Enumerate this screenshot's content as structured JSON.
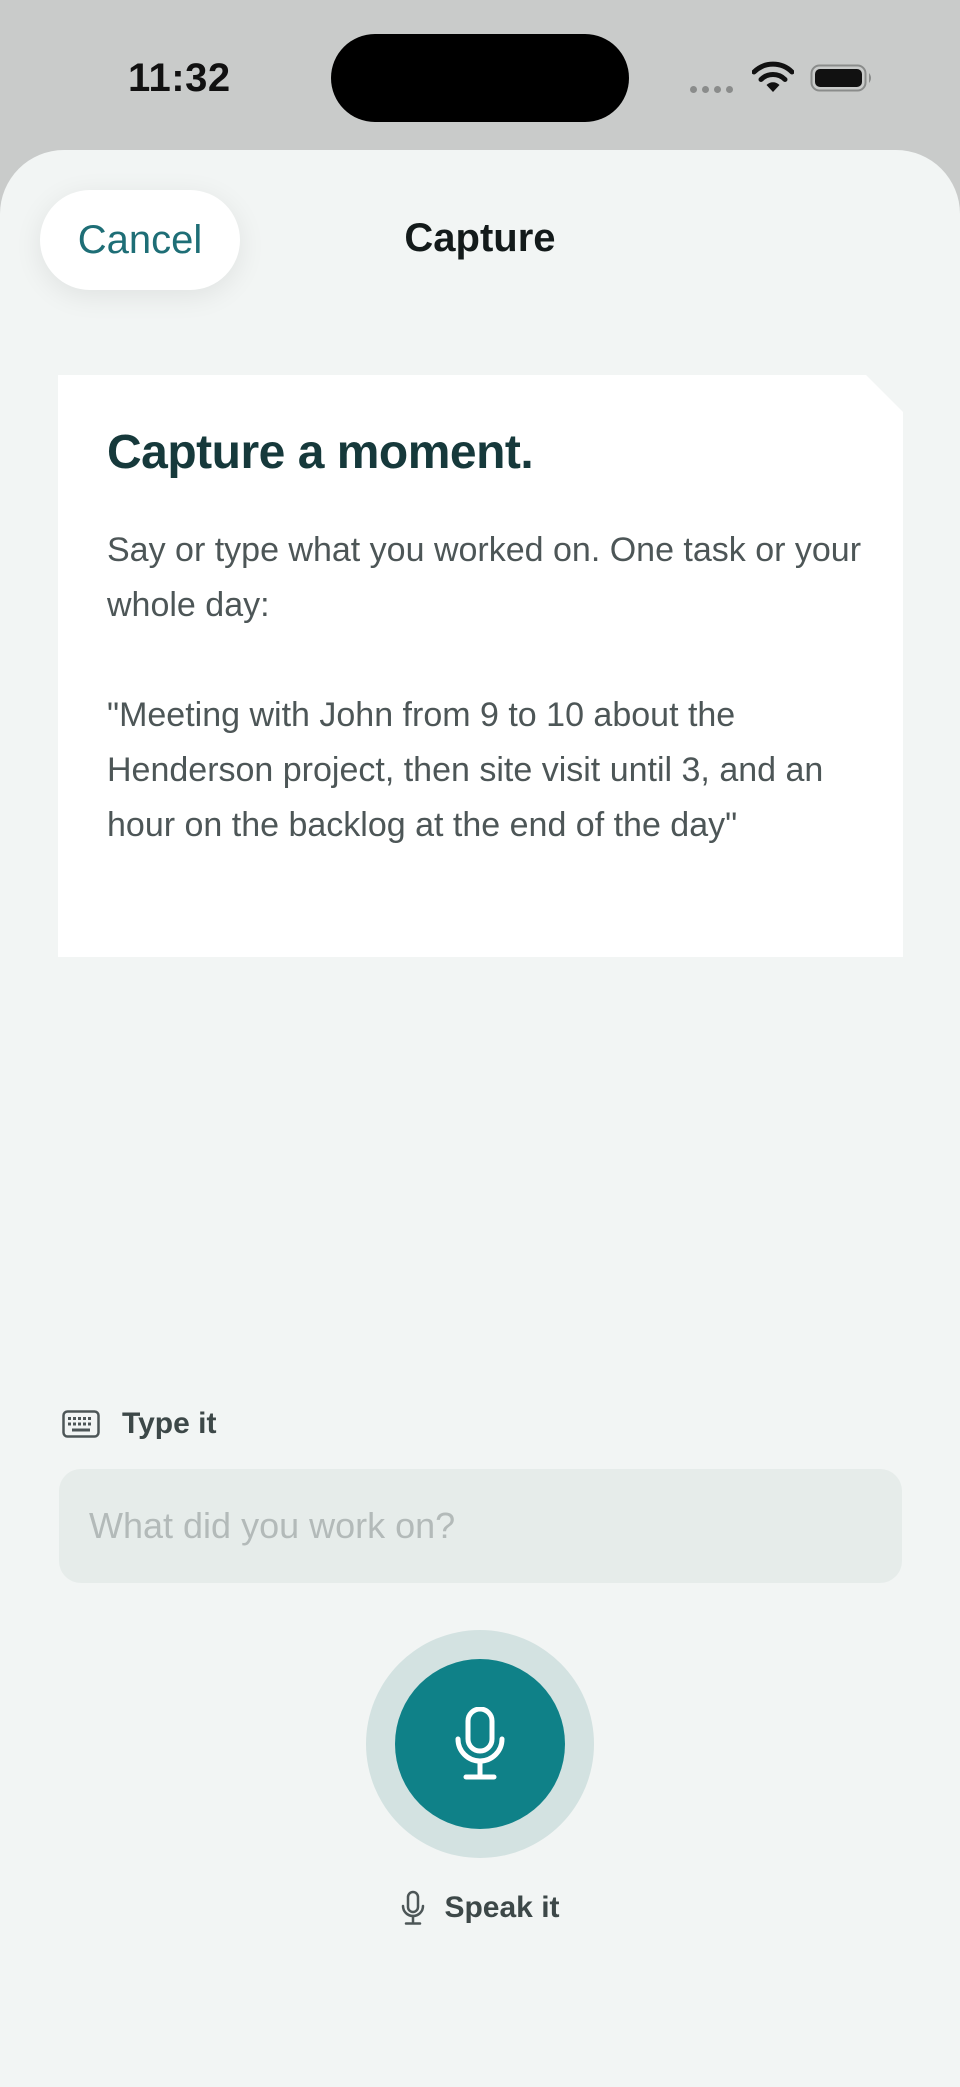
{
  "status_bar": {
    "time": "11:32",
    "icons": [
      "cellular-dots-icon",
      "wifi-icon",
      "battery-icon"
    ]
  },
  "header": {
    "cancel_label": "Cancel",
    "title": "Capture"
  },
  "prompt_card": {
    "heading": "Capture a moment.",
    "instructions": "Say or type what you worked on. One task or your whole day:",
    "example": "\"Meeting with John from 9 to 10 about the Henderson project, then site visit until 3, and an hour on the backlog at the end of the day\""
  },
  "type_section": {
    "icon": "keyboard-icon",
    "label": "Type it",
    "input_placeholder": "What did you work on?",
    "input_value": ""
  },
  "speak_section": {
    "icon": "microphone-icon",
    "label": "Speak it"
  },
  "colors": {
    "accent": "#0f8188",
    "cancel_text": "#1e6e76",
    "heading": "#16393b",
    "sheet_background": "#f2f5f4",
    "mic_halo": "#d3e2e1"
  }
}
